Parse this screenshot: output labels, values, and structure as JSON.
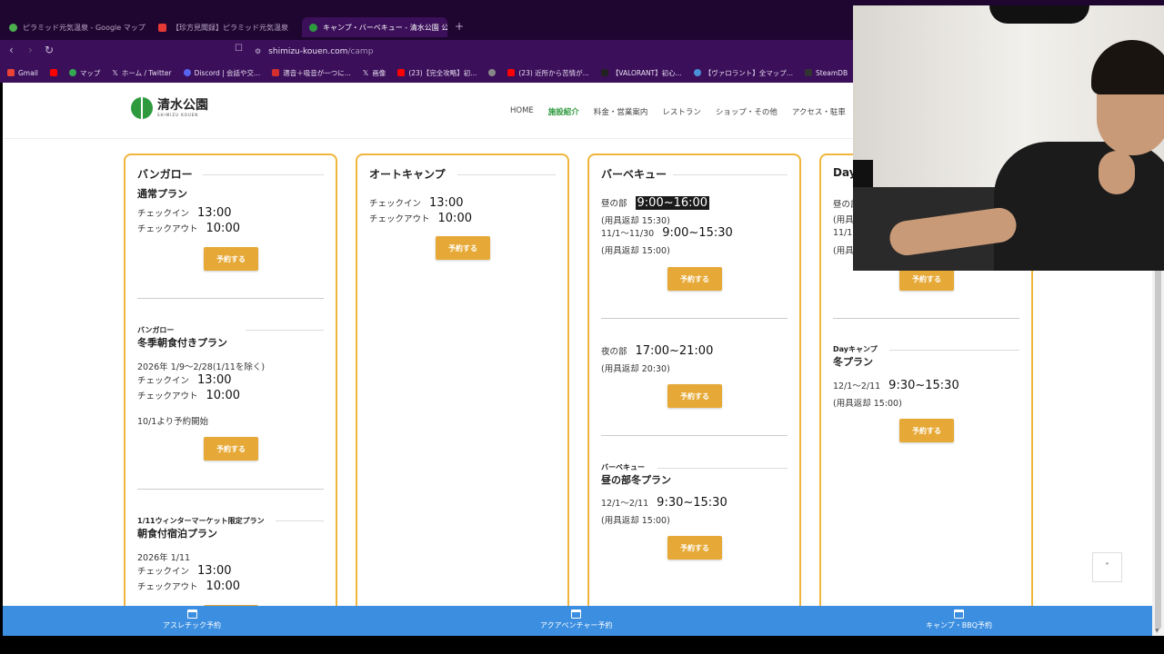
{
  "browser": {
    "tabs": [
      {
        "title": "ピラミッド元気温泉 - Google マップ",
        "color": "#4caf50"
      },
      {
        "title": "【珍方見聞録】ピラミッド元気温泉（栃木",
        "color": "#e53935"
      },
      {
        "title": "キャンプ・バーベキュー - 清水公園 公",
        "color": "#2e9a3e"
      }
    ],
    "new_tab": "+",
    "close": "×",
    "url_host": "shimizu-kouen.com",
    "url_path": "/camp",
    "nav": {
      "back": "‹",
      "forward": "›",
      "reload": "↻"
    },
    "bookmarks": [
      {
        "label": "Gmail",
        "color": "#ea4335"
      },
      {
        "label": "",
        "color": "#ff0000"
      },
      {
        "label": "マップ",
        "color": "#34a853"
      },
      {
        "label": "ホーム / Twitter",
        "color": "#000000"
      },
      {
        "label": "Discord | 会話や交...",
        "color": "#5865f2"
      },
      {
        "label": "適音＋吸音が一つに...",
        "color": "#d32f2f"
      },
      {
        "label": "画像",
        "color": "#000000"
      },
      {
        "label": "(23)【完全攻略】初...",
        "color": "#ff0000"
      },
      {
        "label": "",
        "color": "#888888"
      },
      {
        "label": "(23) 近所から苦情が...",
        "color": "#ff0000"
      },
      {
        "label": "【VALORANT】初心...",
        "color": "#222222"
      },
      {
        "label": "【ヴァロラント】全マップ...",
        "color": "#4a90d9"
      },
      {
        "label": "SteamDB",
        "color": "#333333"
      }
    ]
  },
  "site": {
    "logo_jp": "清水公園",
    "logo_en": "SHIMIZU KOUEN",
    "nav": [
      {
        "label": "HOME",
        "active": false
      },
      {
        "label": "施設紹介",
        "active": true
      },
      {
        "label": "料金・営業案内",
        "active": false
      },
      {
        "label": "レストラン",
        "active": false
      },
      {
        "label": "ショップ・その他",
        "active": false
      },
      {
        "label": "アクセス・駐車",
        "active": false
      }
    ],
    "reserve_label": "予約する",
    "to_top": "˄"
  },
  "cards": {
    "bungalow": {
      "title": "バンガロー",
      "plan1": {
        "name": "通常プラン",
        "checkin_label": "チェックイン",
        "checkin": "13:00",
        "checkout_label": "チェックアウト",
        "checkout": "10:00"
      },
      "plan2": {
        "category": "バンガロー",
        "name": "冬季朝食付きプラン",
        "period": "2026年 1/9〜2/28(1/11を除く)",
        "checkin_label": "チェックイン",
        "checkin": "13:00",
        "checkout_label": "チェックアウト",
        "checkout": "10:00",
        "note": "10/1より予約開始"
      },
      "plan3": {
        "category": "1/11ウィンターマーケット限定プラン",
        "name": "朝食付宿泊プラン",
        "period": "2026年 1/11",
        "checkin_label": "チェックイン",
        "checkin": "13:00",
        "checkout_label": "チェックアウト",
        "checkout": "10:00"
      }
    },
    "autocamp": {
      "title": "オートキャンプ",
      "checkin_label": "チェックイン",
      "checkin": "13:00",
      "checkout_label": "チェックアウト",
      "checkout": "10:00"
    },
    "bbq": {
      "title": "バーベキュー",
      "day": {
        "label": "昼の部",
        "time": "9:00~16:00",
        "return": "(用具返却 15:30)",
        "label2": "11/1〜11/30",
        "time2": "9:00~15:30",
        "return2": "(用具返却 15:00)"
      },
      "night": {
        "label": "夜の部",
        "time": "17:00~21:00",
        "return": "(用具返却 20:30)"
      },
      "winter": {
        "category": "バーベキュー",
        "name": "昼の部冬プラン",
        "label": "12/1〜2/11",
        "time": "9:30~15:30",
        "return": "(用具返却 15:00)"
      }
    },
    "daycamp": {
      "title": "Day",
      "row1": "昼の部",
      "row2": "(用具",
      "row3": "11/1",
      "row4": "(用具",
      "winter": {
        "category": "Dayキャンプ",
        "name": "冬プラン",
        "label": "12/1〜2/11",
        "time": "9:30~15:30",
        "return": "(用具返却 15:00)"
      }
    }
  },
  "bottom_bar": [
    {
      "label": "アスレチック予約"
    },
    {
      "label": "アクアベンチャー予約"
    },
    {
      "label": "キャンプ・BBQ予約"
    }
  ]
}
